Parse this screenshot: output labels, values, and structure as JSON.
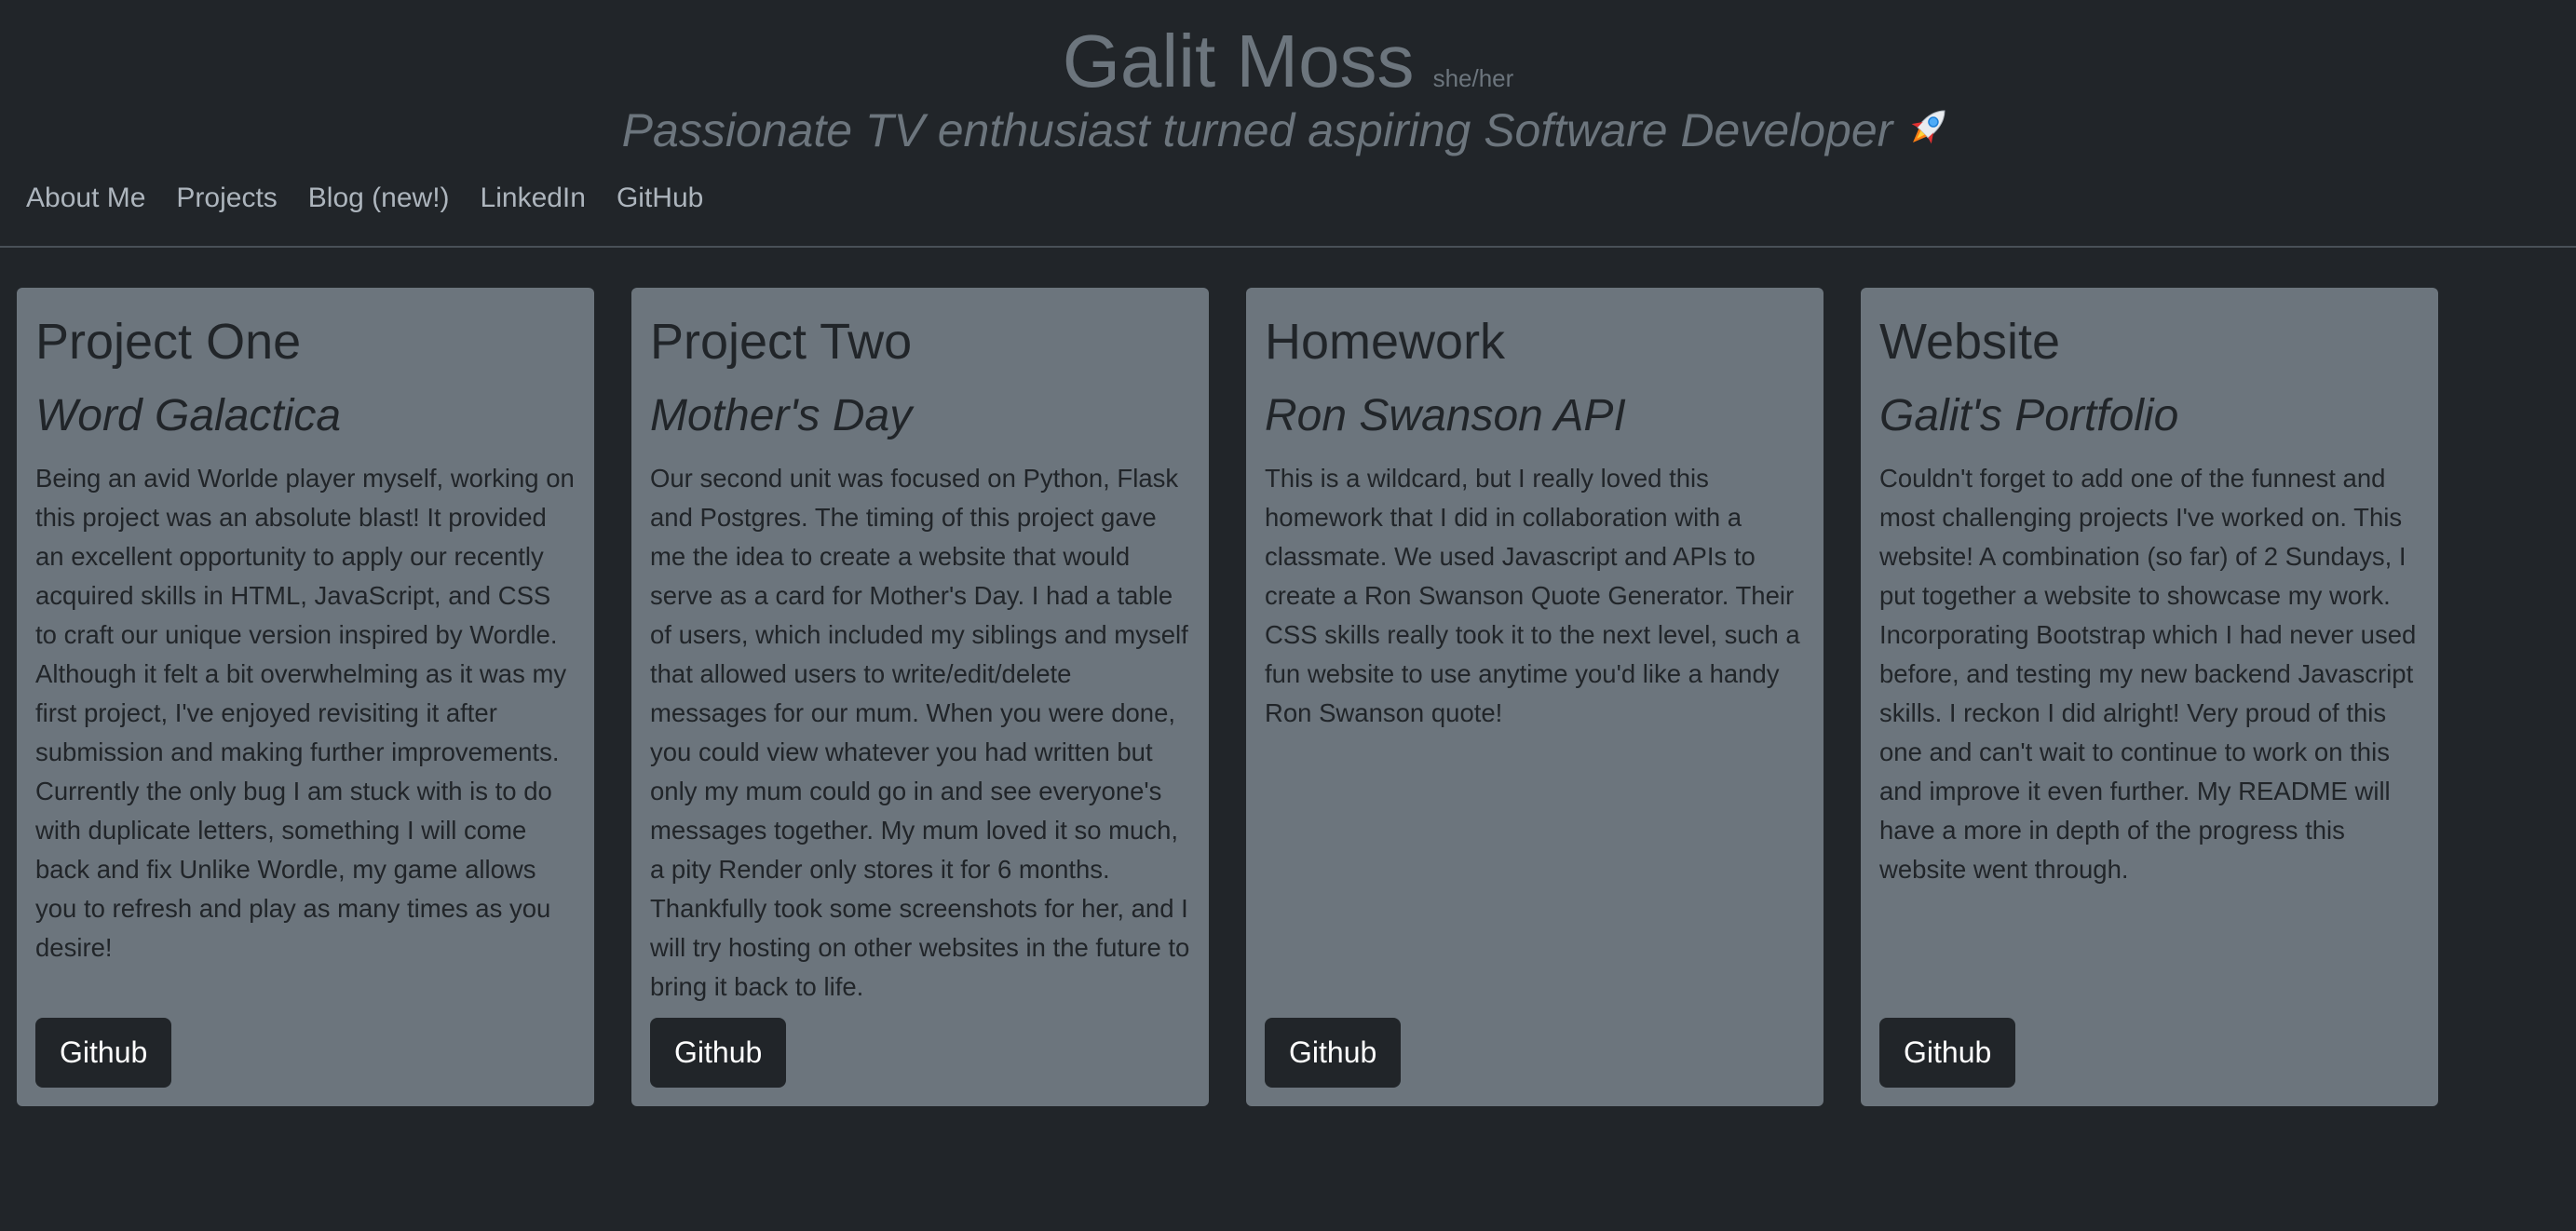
{
  "header": {
    "name": "Galit Moss",
    "pronouns": "she/her",
    "tagline": "Passionate TV enthusiast turned aspiring Software Developer",
    "tagline_icon": "rocket-icon"
  },
  "nav": {
    "items": [
      {
        "label": "About Me"
      },
      {
        "label": "Projects"
      },
      {
        "label": "Blog (new!)"
      },
      {
        "label": "LinkedIn"
      },
      {
        "label": "GitHub"
      }
    ]
  },
  "cards": [
    {
      "title": "Project One",
      "subtitle": "Word Galactica",
      "text": "Being an avid Worlde player myself, working on this project was an absolute blast! It provided an excellent opportunity to apply our recently acquired skills in HTML, JavaScript, and CSS to craft our unique version inspired by Wordle. Although it felt a bit overwhelming as it was my first project, I've enjoyed revisiting it after submission and making further improvements. Currently the only bug I am stuck with is to do with duplicate letters, something I will come back and fix Unlike Wordle, my game allows you to refresh and play as many times as you desire!",
      "button": "Github"
    },
    {
      "title": "Project Two",
      "subtitle": "Mother's Day",
      "text": "Our second unit was focused on Python, Flask and Postgres. The timing of this project gave me the idea to create a website that would serve as a card for Mother's Day. I had a table of users, which included my siblings and myself that allowed users to write/edit/delete messages for our mum. When you were done, you could view whatever you had written but only my mum could go in and see everyone's messages together. My mum loved it so much, a pity Render only stores it for 6 months. Thankfully took some screenshots for her, and I will try hosting on other websites in the future to bring it back to life.",
      "button": "Github"
    },
    {
      "title": "Homework",
      "subtitle": "Ron Swanson API",
      "text": "This is a wildcard, but I really loved this homework that I did in collaboration with a classmate. We used Javascript and APIs to create a Ron Swanson Quote Generator. Their CSS skills really took it to the next level, such a fun website to use anytime you'd like a handy Ron Swanson quote!",
      "button": "Github"
    },
    {
      "title": "Website",
      "subtitle": "Galit's Portfolio",
      "text": "Couldn't forget to add one of the funnest and most challenging projects I've worked on. This website! A combination (so far) of 2 Sundays, I put together a website to showcase my work. Incorporating Bootstrap which I had never used before, and testing my new backend Javascript skills. I reckon I did alright! Very proud of this one and can't wait to continue to work on this and improve it even further. My README will have a more in depth of the progress this website went through.",
      "button": "Github"
    }
  ],
  "colors": {
    "background": "#212529",
    "card": "#6c757d",
    "muted_text": "#6c757d",
    "nav_text": "#adb5bd",
    "button_bg": "#212529",
    "button_text": "#ffffff"
  }
}
